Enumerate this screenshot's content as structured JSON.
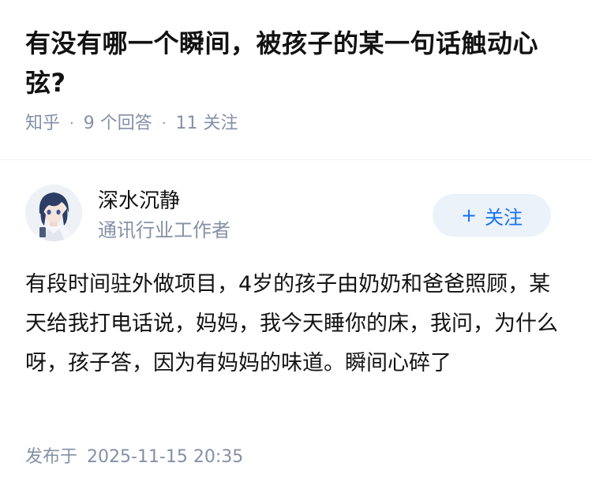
{
  "question": {
    "title": "有没有哪一个瞬间，被孩子的某一句话触动心弦?",
    "source": "知乎",
    "separator": "·",
    "answer_count": "9 个回答",
    "follow_count": "11 关注"
  },
  "author": {
    "name": "深水沉静",
    "bio": "通讯行业工作者",
    "avatar_icon": "anime-avatar-icon",
    "follow_plus": "+",
    "follow_label": "关注"
  },
  "answer": {
    "content": "有段时间驻外做项目，4岁的孩子由奶奶和爸爸照顾，某天给我打电话说，妈妈，我今天睡你的床，我问，为什么呀，孩子答，因为有妈妈的味道。瞬间心碎了",
    "publish_label": "发布于",
    "publish_time": "2025-11-15 20:35"
  },
  "colors": {
    "text_primary": "#121212",
    "text_secondary": "#8590a6",
    "accent": "#1772f6",
    "follow_bg": "#ebf2fa"
  }
}
